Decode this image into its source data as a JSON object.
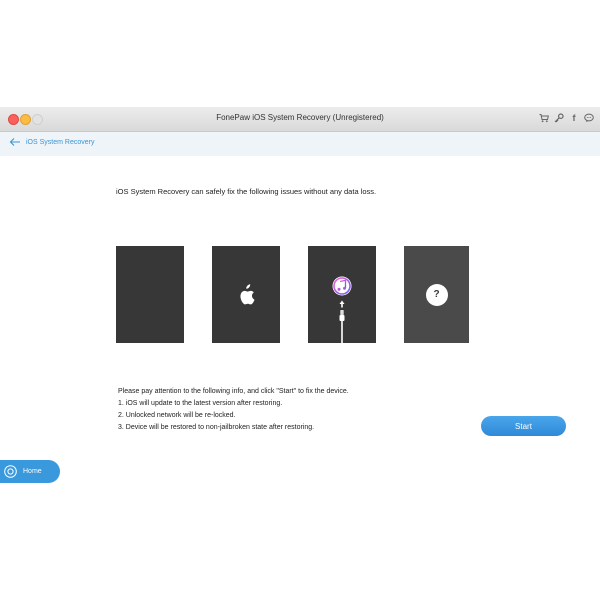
{
  "window": {
    "title": "FonePaw iOS System Recovery (Unregistered)",
    "toolbar_icons": [
      "cart-icon",
      "key-icon",
      "facebook-icon",
      "chat-icon"
    ]
  },
  "nav": {
    "back_icon": "back-arrow-icon",
    "label": "iOS System Recovery"
  },
  "main": {
    "headline": "iOS System Recovery can safely fix the following issues without any data loss.",
    "tiles": [
      {
        "name": "black-screen",
        "icon": "none"
      },
      {
        "name": "apple-logo-stuck",
        "icon": "apple-icon"
      },
      {
        "name": "itunes-connect",
        "icon": "itunes-icon"
      },
      {
        "name": "unknown-issue",
        "icon": "question-icon",
        "symbol": "?"
      }
    ],
    "notes": {
      "intro": "Please pay attention to the following info, and click \"Start\" to fix the device.",
      "items": [
        "1. iOS will update to the latest version after restoring.",
        "2. Unlocked network will be re-locked.",
        "3. Device will be restored to non-jailbroken state after restoring."
      ]
    },
    "start_label": "Start"
  },
  "home": {
    "label": "Home",
    "icon": "home-icon"
  },
  "colors": {
    "accent": "#3a98dc",
    "tile_dark": "#373737",
    "tile_gray": "#4a4a4a",
    "nav_bg": "#eef4f8"
  }
}
